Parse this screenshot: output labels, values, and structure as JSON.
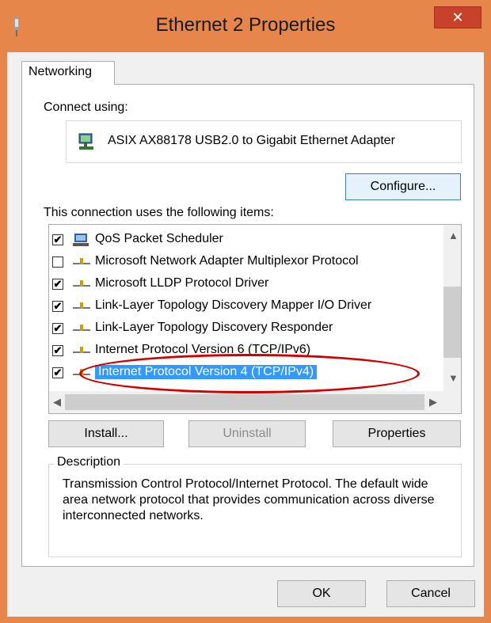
{
  "window": {
    "title": "Ethernet 2 Properties",
    "close_glyph": "✕",
    "frame_color": "#e6864b",
    "close_color": "#c7412b"
  },
  "tabs": [
    {
      "label": "Networking",
      "active": true
    }
  ],
  "connect_using_label": "Connect using:",
  "adapter": {
    "name": "ASIX AX88178 USB2.0 to Gigabit Ethernet Adapter",
    "icon": "network-adapter-icon"
  },
  "buttons": {
    "configure": "Configure...",
    "install": "Install...",
    "uninstall": "Uninstall",
    "properties": "Properties",
    "ok": "OK",
    "cancel": "Cancel"
  },
  "items_label": "This connection uses the following items:",
  "items": [
    {
      "label": "QoS Packet Scheduler",
      "checked": true,
      "icon": "qos-scheduler-icon"
    },
    {
      "label": "Microsoft Network Adapter Multiplexor Protocol",
      "checked": false,
      "icon": "protocol-icon"
    },
    {
      "label": "Microsoft LLDP Protocol Driver",
      "checked": true,
      "icon": "protocol-icon"
    },
    {
      "label": "Link-Layer Topology Discovery Mapper I/O Driver",
      "checked": true,
      "icon": "protocol-icon"
    },
    {
      "label": "Link-Layer Topology Discovery Responder",
      "checked": true,
      "icon": "protocol-icon"
    },
    {
      "label": "Internet Protocol Version 6 (TCP/IPv6)",
      "checked": true,
      "icon": "protocol-icon"
    },
    {
      "label": "Internet Protocol Version 4 (TCP/IPv4)",
      "checked": true,
      "icon": "protocol-icon",
      "selected": true
    }
  ],
  "description": {
    "legend": "Description",
    "text": "Transmission Control Protocol/Internet Protocol. The default wide area network protocol that provides communication across diverse interconnected networks."
  },
  "selection_color": "#3399ff",
  "highlight_ellipse_color": "#d10000"
}
